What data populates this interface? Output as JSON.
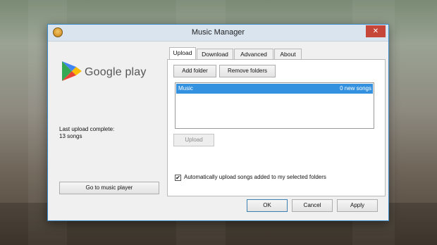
{
  "window": {
    "title": "Music Manager",
    "close_glyph": "✕",
    "icon": "music-manager-app-icon"
  },
  "brand": {
    "text": "Google play"
  },
  "status": {
    "line1": "Last upload complete:",
    "line2": "13 songs"
  },
  "left_panel": {
    "go_button": "Go to music player"
  },
  "tabs": [
    {
      "label": "Upload",
      "active": true
    },
    {
      "label": "Download",
      "active": false
    },
    {
      "label": "Advanced",
      "active": false
    },
    {
      "label": "About",
      "active": false
    }
  ],
  "upload": {
    "add_folder": "Add folder",
    "remove_folders": "Remove folders",
    "folders": [
      {
        "name": "Music",
        "status": "0 new songs"
      }
    ],
    "upload_button": "Upload",
    "auto_upload_label": "Automatically upload songs added to my selected folders",
    "auto_upload_checked": true,
    "check_glyph": "✔"
  },
  "footer": {
    "ok": "OK",
    "cancel": "Cancel",
    "apply": "Apply"
  }
}
